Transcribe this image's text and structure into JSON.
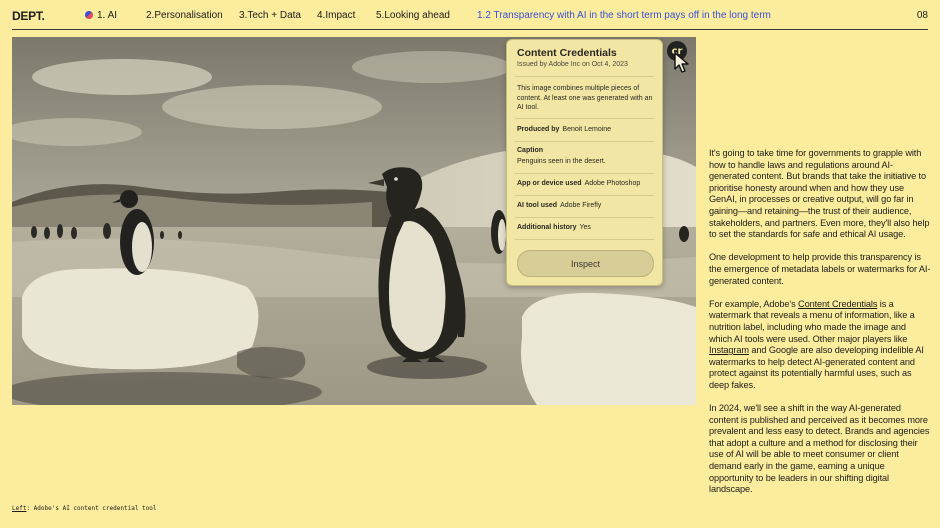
{
  "header": {
    "logo": "DEPT.",
    "nav": [
      "1. AI",
      "2.Personalisation",
      "3.Tech + Data",
      "4.Impact",
      "5.Looking ahead"
    ],
    "active_section": "1.2 Transparency with AI in the short term pays off in the long term",
    "page_number": "08"
  },
  "image_caption": {
    "label": "Left",
    "text": ": Adobe's AI content credential tool"
  },
  "credential_panel": {
    "badge": "cr",
    "title": "Content Credentials",
    "issued": "Issued by Adobe Inc on Oct 4, 2023",
    "description": "This image combines multiple pieces of content. At least one was generated with an AI tool.",
    "produced_by_label": "Produced by",
    "produced_by_value": "Benoit Lemoine",
    "caption_label": "Caption",
    "caption_value": "Penguins seen in the desert.",
    "app_label": "App or device used",
    "app_value": "Adobe Photoshop",
    "ai_tool_label": "AI tool used",
    "ai_tool_value": "Adobe Firefly",
    "history_label": "Additional history",
    "history_value": "Yes",
    "inspect_button": "Inspect"
  },
  "article": {
    "p1": "It's going to take time for governments to grapple with how to handle laws and regulations around AI-generated content. But brands that take the initiative to prioritise honesty around when and how they use GenAI, in processes or creative output, will go far in gaining—and retaining—the trust of their audience, stakeholders, and partners. Even more, they'll also help to set the standards for safe and ethical AI usage.",
    "p2": "One development to help provide this transparency is the emergence of metadata labels or watermarks for AI-generated content.",
    "p3_a": "For example, Adobe's ",
    "p3_link1": "Content Credentials",
    "p3_b": " is a watermark that reveals a menu of information, like a nutrition label, including who made the image and which AI tools were used. Other major players like ",
    "p3_link2": "Instagram",
    "p3_c": " and Google are also developing indelible AI watermarks to help detect AI-generated content and protect against its potentially harmful uses, such as deep fakes.",
    "p4": "In 2024, we'll see a shift in the way AI-generated content is published and perceived as it becomes more prevalent and less easy to detect. Brands and agencies that adopt a culture and a method for disclosing their use of AI will be able to meet consumer or client demand early in the game, earning a unique opportunity to be leaders in our shifting digital landscape."
  }
}
